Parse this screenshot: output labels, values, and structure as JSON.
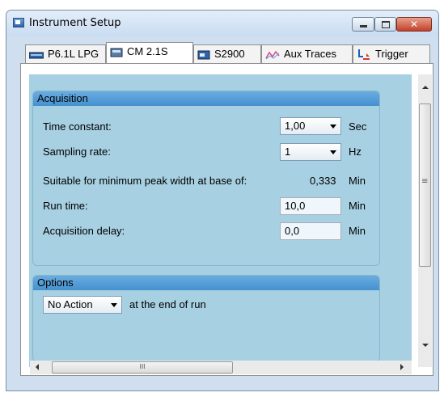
{
  "window": {
    "title": "Instrument Setup",
    "close_glyph": "✕"
  },
  "tabs": [
    {
      "label": "P6.1L LPG",
      "icon": "pump-icon"
    },
    {
      "label": "CM 2.1S",
      "icon": "column-manager-icon"
    },
    {
      "label": "S2900",
      "icon": "detector-icon"
    },
    {
      "label": "Aux Traces",
      "icon": "aux-traces-icon"
    },
    {
      "label": "Trigger",
      "icon": "trigger-icon"
    }
  ],
  "acquisition": {
    "header": "Acquisition",
    "time_constant": {
      "label": "Time constant:",
      "value": "1,00",
      "unit": "Sec"
    },
    "sampling_rate": {
      "label": "Sampling rate:",
      "value": "1",
      "unit": "Hz"
    },
    "peak_width": {
      "label": "Suitable for minimum peak width at base of:",
      "value": "0,333",
      "unit": "Min"
    },
    "run_time": {
      "label": "Run time:",
      "value": "10,0",
      "unit": "Min"
    },
    "acquisition_delay": {
      "label": "Acquisition delay:",
      "value": "0,0",
      "unit": "Min"
    }
  },
  "options": {
    "header": "Options",
    "end_action": {
      "value": "No Action",
      "suffix": "at the end of run"
    }
  },
  "scrollbar": {
    "grip": "≡",
    "h_grip": "III"
  },
  "colors": {
    "group_header": "#5ba0d8",
    "content_bg": "#a7d0e2",
    "close_button": "#c5402a"
  }
}
